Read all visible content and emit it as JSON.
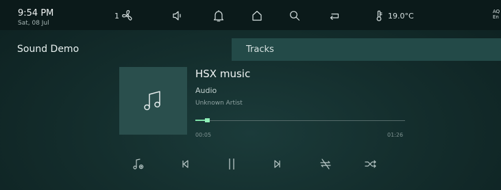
{
  "status": {
    "time": "9:54 PM",
    "date": "Sat, 08 Jul",
    "fan_level": "1",
    "temperature": "19.0°C",
    "edge_line1": "AQ",
    "edge_line2": "En"
  },
  "icons": {
    "fan": "fan-icon",
    "volume": "speaker-icon",
    "notifications": "bell-icon",
    "home": "home-icon",
    "search": "search-icon",
    "back": "return-icon",
    "thermometer": "thermometer-icon",
    "album": "music-note-icon",
    "playlist": "playlist-settings-icon",
    "previous": "skip-previous-icon",
    "pause": "pause-icon",
    "next": "skip-next-icon",
    "repeat": "repeat-off-icon",
    "shuffle": "shuffle-icon"
  },
  "header": {
    "title": "Sound Demo",
    "tab_label": "Tracks"
  },
  "now_playing": {
    "title": "HSX music",
    "type": "Audio",
    "artist": "Unknown Artist",
    "elapsed": "00:05",
    "duration": "01:26",
    "progress_fraction": 0.058
  },
  "colors": {
    "accent": "#7fe0a9",
    "panel": "#234a48",
    "background": "#142e2d"
  }
}
